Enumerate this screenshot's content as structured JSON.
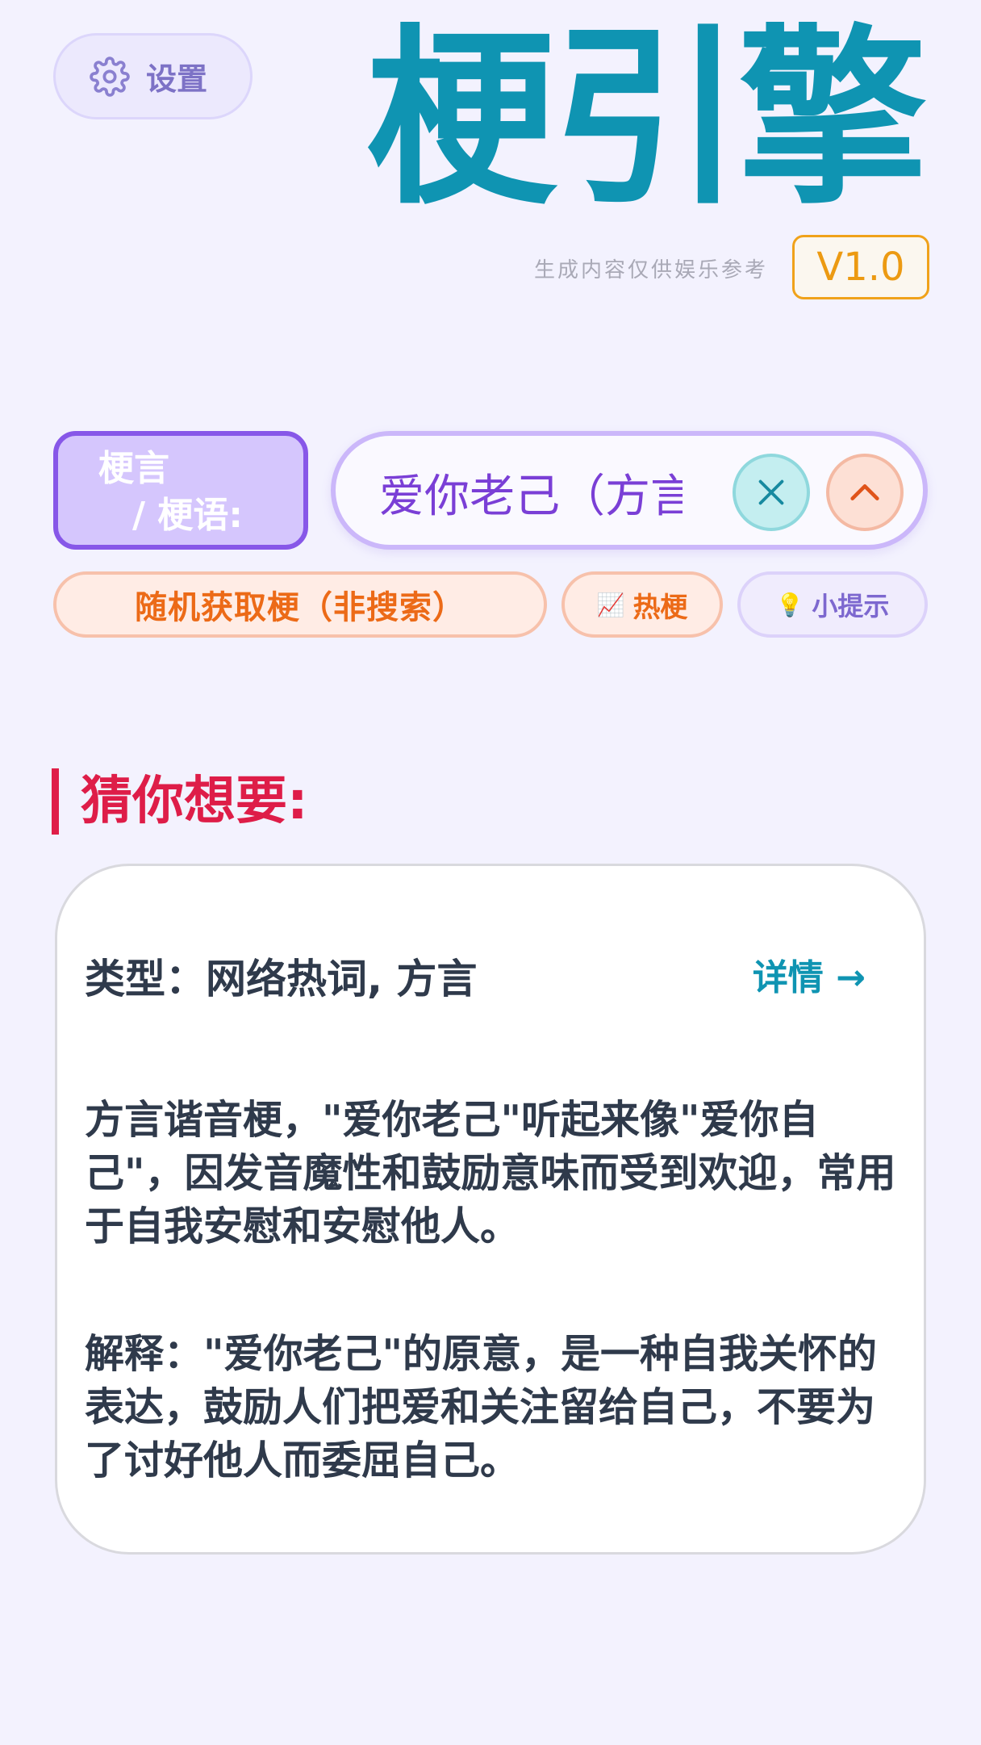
{
  "settings": {
    "label": "设置",
    "icon": "gear-icon"
  },
  "header": {
    "title": "梗引擎",
    "disclaimer": "生成内容仅供娱乐参考",
    "version": "V1.0"
  },
  "search": {
    "label_line1": "梗言",
    "label_line2": "/ 梗语:",
    "value": "爱你老己（方言）",
    "clear_icon": "close-icon",
    "collapse_icon": "chevron-up-icon"
  },
  "actions": {
    "random": "随机获取梗（非搜索）",
    "hot_icon": "📈",
    "hot": "热梗",
    "tips_icon": "💡",
    "tips": "小提示"
  },
  "result": {
    "section_title": "猜你想要:",
    "type": "类型：网络热词, 方言",
    "detail": "详情 →",
    "description": "方言谐音梗，\"爱你老己\"听起来像\"爱你自己\"，因发音魔性和鼓励意味而受到欢迎，常用于自我安慰和安慰他人。",
    "explanation": "解释：\"爱你老己\"的原意，是一种自我关怀的表达，鼓励人们把爱和关注留给自己，不要为了讨好他人而委屈自己。"
  },
  "colors": {
    "background": "#f3f2fe",
    "title": "#0f94b2",
    "accent_purple": "#8757e8",
    "accent_orange": "#ec6a17",
    "section_red": "#de1d48",
    "version": "#ec9a12"
  }
}
